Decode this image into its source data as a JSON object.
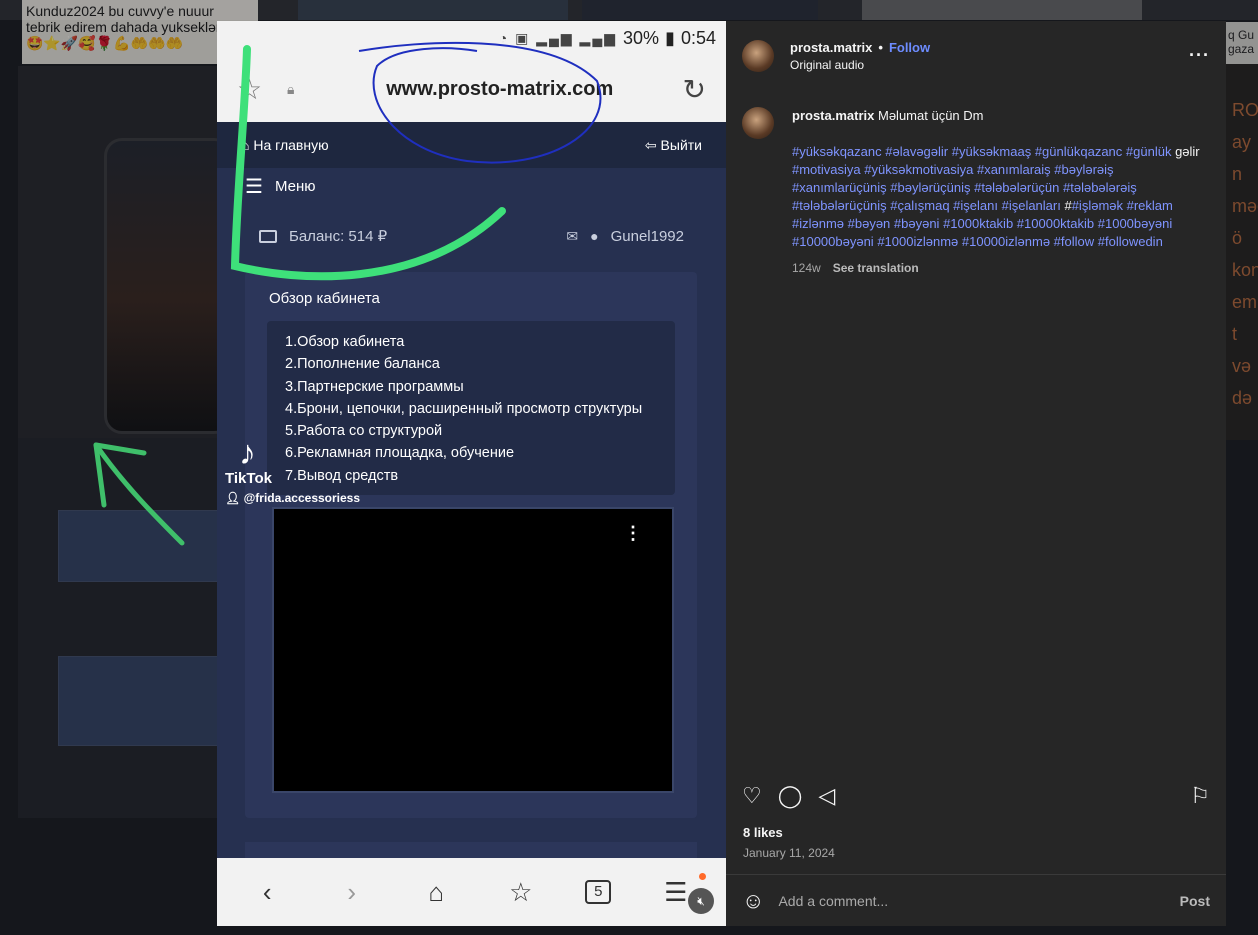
{
  "background": {
    "chat_lines": [
      "Kunduz2024 bu cuvvy'e nuuur",
      "tebrik edirem dahada yuksekləre",
      "🤩⭐🚀🥰🌹💪🤲🤲🤲"
    ],
    "right_top_text": "q Gu gaza",
    "right_panel_text": [
      "ROS",
      "ay n",
      "məc",
      "ö",
      "kon",
      "emb",
      "t və",
      "də"
    ]
  },
  "phone": {
    "status": {
      "battery": "30%",
      "time": "0:54"
    },
    "url": "www.prosto-matrix.com",
    "site": {
      "home_label": "На главную",
      "logout_label": "Выйти",
      "menu_label": "Меню",
      "balance_label": "Баланс: 514 ₽",
      "username": "Gunel1992",
      "cabinet_title": "Обзор кабинета",
      "cabinet_items": [
        "1.Обзор кабинета",
        "2.Пополнение баланса",
        "3.Партнерские программы",
        "4.Брони, цепочки, расширенный просмотр структуры",
        "5.Работа со структурой",
        "6.Рекламная площадка, обучение",
        "7.Вывод средств"
      ]
    },
    "tiktok": {
      "brand": "TikTok",
      "user": "@frida.accessoriess"
    },
    "nav_tabs_count": "5"
  },
  "post": {
    "username": "prosta.matrix",
    "separator": "•",
    "follow_label": "Follow",
    "audio": "Original audio",
    "caption_text": "Məlumat üçün Dm",
    "hashtags": [
      {
        "t": "#yüksəkqazanc ",
        "plain": false
      },
      {
        "t": "#əlavəgəlir ",
        "plain": false
      },
      {
        "t": "#yüksəkmaaş ",
        "plain": false
      },
      {
        "t": "#günlükqazanc ",
        "plain": false
      },
      {
        "t": "#günlük ",
        "plain": false
      },
      {
        "t": "gəlir ",
        "plain": true
      },
      {
        "t": "#motivasiya ",
        "plain": false
      },
      {
        "t": "#yüksəkmotivasiya ",
        "plain": false
      },
      {
        "t": "#xanımlaraiş ",
        "plain": false
      },
      {
        "t": "#bəylərəiş ",
        "plain": false
      },
      {
        "t": "#xanımlarüçüniş ",
        "plain": false
      },
      {
        "t": "#bəylərüçüniş ",
        "plain": false
      },
      {
        "t": "#tələbələrüçün ",
        "plain": false
      },
      {
        "t": "#tələbələrəiş ",
        "plain": false
      },
      {
        "t": "#tələbələrüçüniş ",
        "plain": false
      },
      {
        "t": "#çalışmaq ",
        "plain": false
      },
      {
        "t": "#işelanı ",
        "plain": false
      },
      {
        "t": "#işelanları ",
        "plain": false
      },
      {
        "t": "#",
        "plain": true
      },
      {
        "t": "#işləmək ",
        "plain": false
      },
      {
        "t": "#reklam ",
        "plain": false
      },
      {
        "t": "#izlənmə ",
        "plain": false
      },
      {
        "t": "#bəyən ",
        "plain": false
      },
      {
        "t": "#bəyəni ",
        "plain": false
      },
      {
        "t": "#1000ktakib ",
        "plain": false
      },
      {
        "t": "#10000ktakib ",
        "plain": false
      },
      {
        "t": "#1000bəyəni ",
        "plain": false
      },
      {
        "t": "#10000bəyəni ",
        "plain": false
      },
      {
        "t": "#1000izlənmə ",
        "plain": false
      },
      {
        "t": "#10000izlənmə ",
        "plain": false
      },
      {
        "t": "#follow ",
        "plain": false
      },
      {
        "t": "#followedin",
        "plain": false
      }
    ],
    "age": "124w",
    "see_translation": "See translation",
    "likes": "8 likes",
    "date": "January 11, 2024",
    "comment_placeholder": "Add a comment...",
    "post_button": "Post",
    "icons": [
      "heart-icon",
      "comment-icon",
      "share-icon",
      "bookmark-icon",
      "more-icon",
      "emoji-icon"
    ]
  }
}
